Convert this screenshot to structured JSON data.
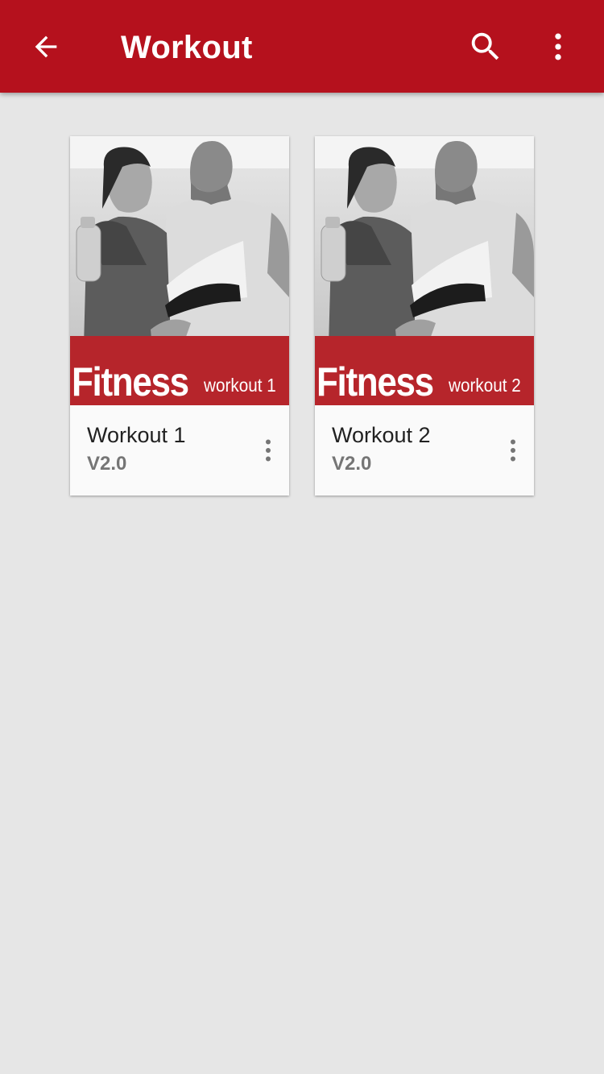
{
  "appbar": {
    "title": "Workout",
    "background": "#b5111d",
    "icons": [
      "arrow-back-icon",
      "search-icon",
      "more-vert-icon"
    ]
  },
  "cards": [
    {
      "title": "Workout 1",
      "version": "V2.0",
      "cover_big": "Fitness",
      "cover_small": "workout 1",
      "cover_band_color": "#b6252b"
    },
    {
      "title": "Workout 2",
      "version": "V2.0",
      "cover_big": "Fitness",
      "cover_small": "workout 2",
      "cover_band_color": "#b6252b"
    }
  ]
}
